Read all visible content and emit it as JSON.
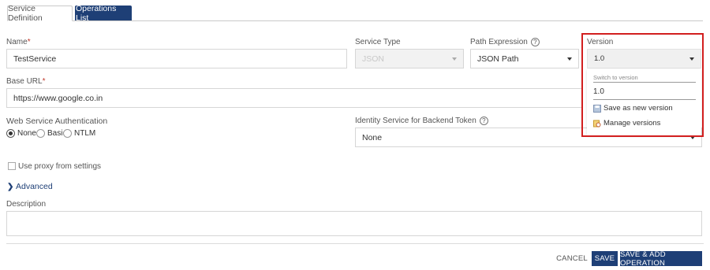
{
  "tabs": [
    {
      "label": "Service Definition"
    },
    {
      "label": "Operations List"
    }
  ],
  "name": {
    "label": "Name",
    "required": "*",
    "value": "TestService"
  },
  "service_type": {
    "label": "Service Type",
    "value": "JSON"
  },
  "path_expression": {
    "label": "Path Expression",
    "help": "?",
    "value": "JSON Path"
  },
  "version": {
    "label": "Version",
    "value": "1.0"
  },
  "version_menu": {
    "switch_label": "Switch to version",
    "options": [
      "1.0"
    ],
    "save_new": "Save as new version",
    "manage": "Manage versions"
  },
  "base_url": {
    "label": "Base URL",
    "required": "*",
    "value": "https://www.google.co.in"
  },
  "auth": {
    "label": "Web Service Authentication",
    "options": [
      {
        "label": "None",
        "selected": true
      },
      {
        "label": "Basic",
        "selected": false
      },
      {
        "label": "NTLM",
        "selected": false
      }
    ]
  },
  "identity": {
    "label": "Identity Service for Backend Token",
    "help": "?",
    "value": "None"
  },
  "proxy": {
    "label": "Use proxy from settings",
    "checked": false
  },
  "advanced": {
    "label": "Advanced"
  },
  "description": {
    "label": "Description",
    "value": ""
  },
  "footer": {
    "cancel": "CANCEL",
    "save": "SAVE",
    "save_add": "SAVE & ADD OPERATION"
  },
  "colors": {
    "primary": "#1e3f76",
    "highlight": "#d21f1f",
    "required": "#c0392b"
  }
}
